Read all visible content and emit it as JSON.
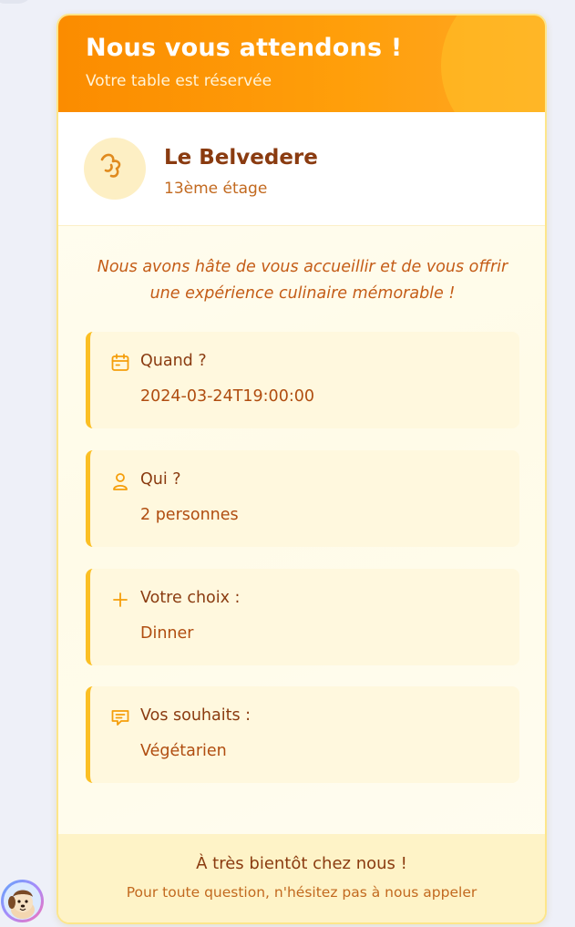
{
  "header": {
    "title": "Nous vous attendons !",
    "subtitle": "Votre table est réservée"
  },
  "restaurant": {
    "name": "Le Belvedere",
    "floor": "13ème étage",
    "logo_icon": "chef-hat-icon"
  },
  "tagline": "Nous avons hâte de vous accueillir et de vous offrir une expérience culinaire mémorable !",
  "details": [
    {
      "icon": "calendar-icon",
      "label": "Quand ?",
      "value": "2024-03-24T19:00:00"
    },
    {
      "icon": "user-icon",
      "label": "Qui ?",
      "value": "2 personnes"
    },
    {
      "icon": "plus-icon",
      "label": "Votre choix :",
      "value": "Dinner"
    },
    {
      "icon": "message-icon",
      "label": "Vos souhaits :",
      "value": "Végétarien"
    }
  ],
  "footer": {
    "main": "À très bientôt chez nous !",
    "small": "Pour toute question, n'hésitez pas à nous appeler"
  },
  "colors": {
    "accent": "#fb8c00",
    "border": "#fbbf24",
    "text_dark": "#8a3b10"
  }
}
